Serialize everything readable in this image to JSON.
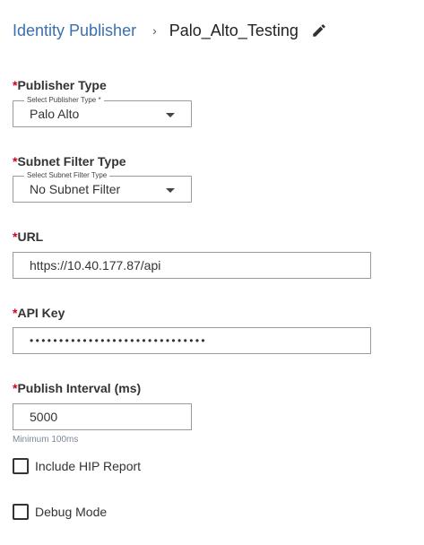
{
  "breadcrumb": {
    "parent": "Identity Publisher",
    "separator": "›",
    "current": "Palo_Alto_Testing",
    "edit_icon": "pencil-icon"
  },
  "required_marker": "*",
  "publisher_type": {
    "label": "Publisher Type",
    "legend": "Select Publisher Type *",
    "value": "Palo Alto",
    "icon": "caret-down-icon"
  },
  "subnet_filter_type": {
    "label": "Subnet Filter Type",
    "legend": "Select Subnet Filter Type",
    "value": "No Subnet Filter",
    "icon": "caret-down-icon"
  },
  "url": {
    "label": "URL",
    "value": "https://10.40.177.87/api"
  },
  "api_key": {
    "label": "API Key",
    "masked_value": "••••••••••••••••••••••••••••••"
  },
  "publish_interval": {
    "label": "Publish Interval (ms)",
    "value": "5000",
    "hint": "Minimum 100ms"
  },
  "include_hip_report": {
    "label": "Include HIP Report",
    "checked": false
  },
  "debug_mode": {
    "label": "Debug Mode",
    "checked": false
  },
  "colors": {
    "link": "#3a6fb0",
    "required": "#d0021b",
    "hint": "#7a8a99",
    "border": "#9a9a9a"
  }
}
